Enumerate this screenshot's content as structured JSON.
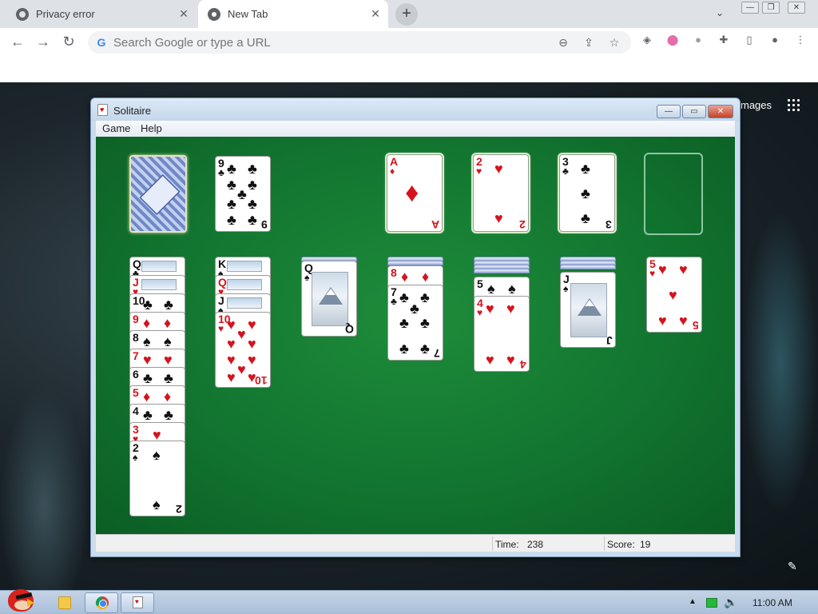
{
  "browser": {
    "tabs": [
      {
        "label": "Privacy error",
        "active": false
      },
      {
        "label": "New Tab",
        "active": true
      }
    ],
    "omnibox_placeholder": "Search Google or type a URL",
    "icons": {
      "back": "arrow-left-icon",
      "forward": "arrow-right-icon",
      "reload": "reload-icon",
      "zoom": "zoom-icon",
      "share": "share-icon",
      "bookmark": "star-icon",
      "extensions": "puzzle-icon",
      "side_panel": "side-panel-icon",
      "profile": "profile-icon",
      "menu": "kebab-menu-icon"
    },
    "glyphs": {
      "close": "✕",
      "new_tab": "+",
      "tab_search": "⌄",
      "minimize": "—",
      "restore": "❐",
      "back": "←",
      "forward": "→",
      "reload": "↻",
      "zoom": "⊖",
      "share": "⇪",
      "star": "☆",
      "ext1": "◈",
      "ext2": "⬤",
      "ext3": "●",
      "puzzle": "✚",
      "panel": "▯",
      "profile": "●",
      "menu": "⋮",
      "g": "G"
    }
  },
  "new_tab_page": {
    "images_link": "mages",
    "customize_glyph": "✎"
  },
  "solitaire": {
    "title": "Solitaire",
    "menu": [
      "Game",
      "Help"
    ],
    "window_glyphs": {
      "minimize": "—",
      "maximize": "▭",
      "close": "✕"
    },
    "status": {
      "time_label": "Time:",
      "time_value": "238",
      "score_label": "Score:",
      "score_value": "19"
    },
    "waste_top": {
      "rank": "9",
      "suit": "♣"
    },
    "foundations": [
      {
        "rank": "A",
        "suit": "♦"
      },
      {
        "rank": "2",
        "suit": "♥"
      },
      {
        "rank": "3",
        "suit": "♣"
      },
      {
        "rank": "",
        "suit": ""
      }
    ],
    "tableau": [
      {
        "visible": [
          {
            "rank": "Q",
            "suit": "♣"
          },
          {
            "rank": "J",
            "suit": "♥"
          },
          {
            "rank": "10",
            "suit": "♣"
          },
          {
            "rank": "9",
            "suit": "♦"
          },
          {
            "rank": "8",
            "suit": "♠"
          },
          {
            "rank": "7",
            "suit": "♥"
          },
          {
            "rank": "6",
            "suit": "♣"
          },
          {
            "rank": "5",
            "suit": "♦"
          },
          {
            "rank": "4",
            "suit": "♣"
          },
          {
            "rank": "3",
            "suit": "♥"
          },
          {
            "rank": "2",
            "suit": "♠"
          }
        ]
      },
      {
        "visible": [
          {
            "rank": "K",
            "suit": "♠"
          },
          {
            "rank": "Q",
            "suit": "♥"
          },
          {
            "rank": "J",
            "suit": "♠"
          },
          {
            "rank": "10",
            "suit": "♥"
          }
        ]
      },
      {
        "visible": [
          {
            "rank": "Q",
            "suit": "♠"
          }
        ]
      },
      {
        "visible": [
          {
            "rank": "8",
            "suit": "♦"
          },
          {
            "rank": "7",
            "suit": "♣"
          }
        ]
      },
      {
        "visible": [
          {
            "rank": "5",
            "suit": "♠"
          },
          {
            "rank": "4",
            "suit": "♥"
          }
        ]
      },
      {
        "visible": [
          {
            "rank": "J",
            "suit": "♠"
          }
        ]
      },
      {
        "visible": [
          {
            "rank": "5",
            "suit": "♥"
          }
        ]
      }
    ]
  },
  "taskbar": {
    "clock": "11:00 AM",
    "tray_arrow": "▲",
    "volume_glyph": "🔈"
  },
  "colors": {
    "felt": "#127530",
    "red_suit": "#d4141e",
    "black_suit": "#111111"
  }
}
